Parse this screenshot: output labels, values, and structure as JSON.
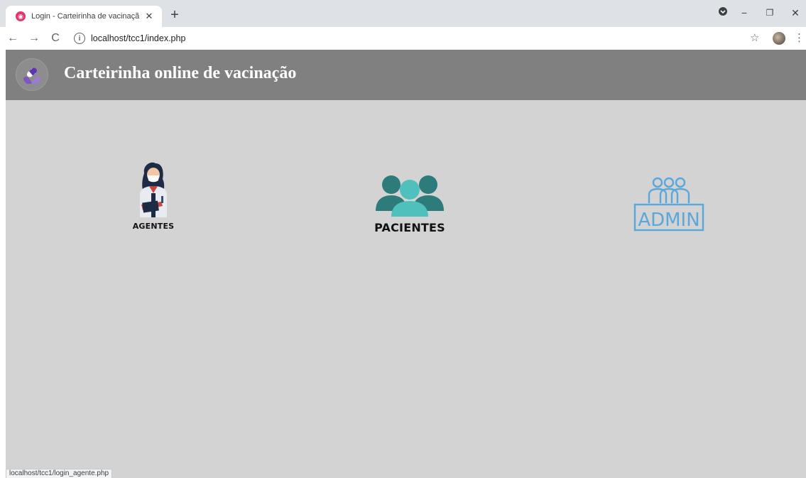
{
  "browser": {
    "tab_title": "Login - Carteirinha de vacinação",
    "url": "localhost/tcc1/index.php",
    "status_url": "localhost/tcc1/login_agente.php"
  },
  "header": {
    "title": "Carteirinha online de vacinação"
  },
  "cards": {
    "agentes": {
      "label": "AGENTES"
    },
    "pacientes": {
      "label": "PACIENTES"
    },
    "admin": {
      "label": "ADMIN"
    }
  },
  "colors": {
    "header_bg": "#808080",
    "page_bg": "#d3d3d3",
    "pacientes_dark": "#2d7b7b",
    "pacientes_light": "#4fc0bc",
    "admin_blue": "#5aa7dc"
  }
}
